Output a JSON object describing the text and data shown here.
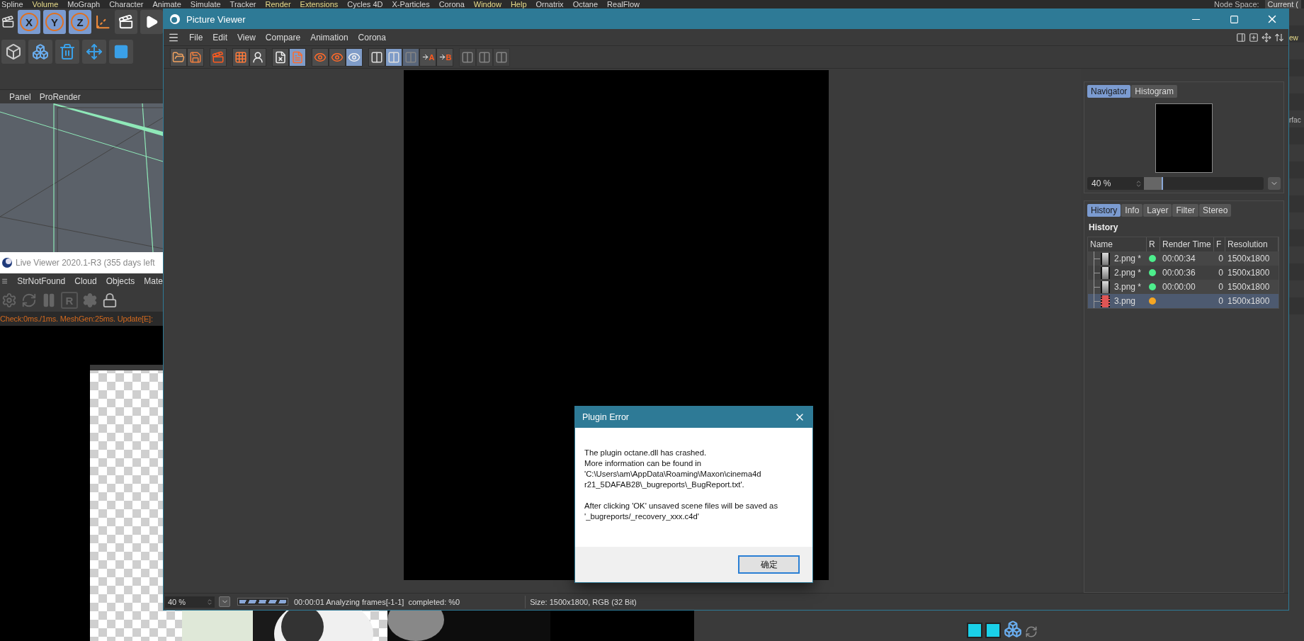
{
  "app_menu": [
    {
      "label": "Spline",
      "color": "#d8d8d8"
    },
    {
      "label": "Volume",
      "color": "#e8dc8a"
    },
    {
      "label": "MoGraph",
      "color": "#d8d8d8"
    },
    {
      "label": "Character",
      "color": "#d8d8d8"
    },
    {
      "label": "Animate",
      "color": "#d8d8d8"
    },
    {
      "label": "Simulate",
      "color": "#d8d8d8"
    },
    {
      "label": "Tracker",
      "color": "#d8d8d8"
    },
    {
      "label": "Render",
      "color": "#e8dc8a"
    },
    {
      "label": "Extensions",
      "color": "#e8dc8a"
    },
    {
      "label": "Cycles 4D",
      "color": "#d8d8d8"
    },
    {
      "label": "X-Particles",
      "color": "#d8d8d8"
    },
    {
      "label": "Corona",
      "color": "#d8d8d8"
    },
    {
      "label": "Window",
      "color": "#e8dc8a"
    },
    {
      "label": "Help",
      "color": "#e8dc8a"
    },
    {
      "label": "Ornatrix",
      "color": "#d8d8d8"
    },
    {
      "label": "Octane",
      "color": "#d8d8d8"
    },
    {
      "label": "RealFlow",
      "color": "#d8d8d8"
    }
  ],
  "node_space": {
    "label": "Node Space:",
    "value": "Current ("
  },
  "axis_buttons": [
    "X",
    "Y",
    "Z"
  ],
  "left_menu": [
    "Panel",
    "ProRender"
  ],
  "live_viewer": {
    "title": "Live Viewer 2020.1-R3 (355 days left",
    "menu": [
      "StrNotFound",
      "Cloud",
      "Objects",
      "Mate"
    ],
    "render_label": "R",
    "status": "Check:0ms./1ms. MeshGen:25ms. Update[E]:"
  },
  "right_edge": [
    "ew",
    "rfac"
  ],
  "viewer": {
    "title": "Picture Viewer",
    "menu": [
      "File",
      "Edit",
      "View",
      "Compare",
      "Animation",
      "Corona"
    ],
    "toolbar": [
      [
        {
          "kind": "open",
          "selected": false,
          "disabled": false
        },
        {
          "kind": "save",
          "selected": false,
          "disabled": false
        }
      ],
      [
        {
          "kind": "stop",
          "selected": false,
          "disabled": false
        }
      ],
      [
        {
          "kind": "grid",
          "selected": false,
          "disabled": false
        },
        {
          "kind": "person",
          "selected": false,
          "disabled": false
        }
      ],
      [
        {
          "kind": "doc_delete",
          "selected": false,
          "disabled": false
        },
        {
          "kind": "doc_list",
          "selected": true,
          "disabled": false
        }
      ],
      [
        {
          "kind": "frame_eye",
          "selected": false,
          "disabled": false
        },
        {
          "kind": "frame_eye",
          "selected": false,
          "disabled": false
        },
        {
          "kind": "circles_eye",
          "selected": true,
          "disabled": false
        }
      ],
      [
        {
          "kind": "split",
          "selected": false,
          "disabled": false
        },
        {
          "kind": "split",
          "selected": true,
          "disabled": false
        },
        {
          "kind": "split",
          "selected": true,
          "disabled": true
        },
        {
          "kind": "arrow_label",
          "label": "A",
          "selected": false,
          "disabled": false
        },
        {
          "kind": "arrow_label",
          "label": "B",
          "selected": false,
          "disabled": false
        }
      ],
      [
        {
          "kind": "split",
          "selected": false,
          "disabled": true
        },
        {
          "kind": "split",
          "selected": false,
          "disabled": true
        },
        {
          "kind": "split",
          "selected": false,
          "disabled": true
        }
      ]
    ],
    "navigator": {
      "tabs": [
        {
          "label": "Navigator",
          "selected": true
        },
        {
          "label": "Histogram",
          "selected": false
        }
      ],
      "zoom": {
        "value": "40 %",
        "level": 0.16
      }
    },
    "info": {
      "tabs": [
        {
          "label": "History",
          "selected": true
        },
        {
          "label": "Info",
          "selected": false
        },
        {
          "label": "Layer",
          "selected": false
        },
        {
          "label": "Filter",
          "selected": false
        },
        {
          "label": "Stereo",
          "selected": false
        }
      ],
      "heading": "History",
      "columns": [
        "Name",
        "R",
        "Render Time",
        "F",
        "Resolution"
      ],
      "rows": [
        {
          "name": "2.png *",
          "color": "#4ded8c",
          "time": "00:00:34",
          "f": "0",
          "resolution": "1500x1800",
          "selected": false
        },
        {
          "name": "2.png *",
          "color": "#4ded8c",
          "time": "00:00:36",
          "f": "0",
          "resolution": "1500x1800",
          "selected": false
        },
        {
          "name": "3.png *",
          "color": "#4ded8c",
          "time": "00:00:00",
          "f": "0",
          "resolution": "1500x1800",
          "selected": false
        },
        {
          "name": "3.png",
          "color": "#f5a623",
          "f": "0",
          "resolution": "1500x1800",
          "selected": true
        }
      ]
    },
    "status": {
      "zoom": "40 %",
      "progress": {
        "level": 1
      },
      "progress_text": "00:00:01 Analyzing frames[-1-1]  completed: %0",
      "size": "Size: 1500x1800, RGB (32 Bit)"
    }
  },
  "dialog": {
    "title": "Plugin Error",
    "paragraphs": [
      "The plugin octane.dll has crashed.\nMore information can be found in\n'C:\\Users\\am\\AppData\\Roaming\\Maxon\\cinema4d\nr21_5DAFAB28\\_bugreports\\_BugReport.txt'.",
      "After clicking 'OK' unsaved scene files will be saved as\n'_bugreports/_recovery_xxx.c4d'"
    ],
    "button": "确定"
  }
}
